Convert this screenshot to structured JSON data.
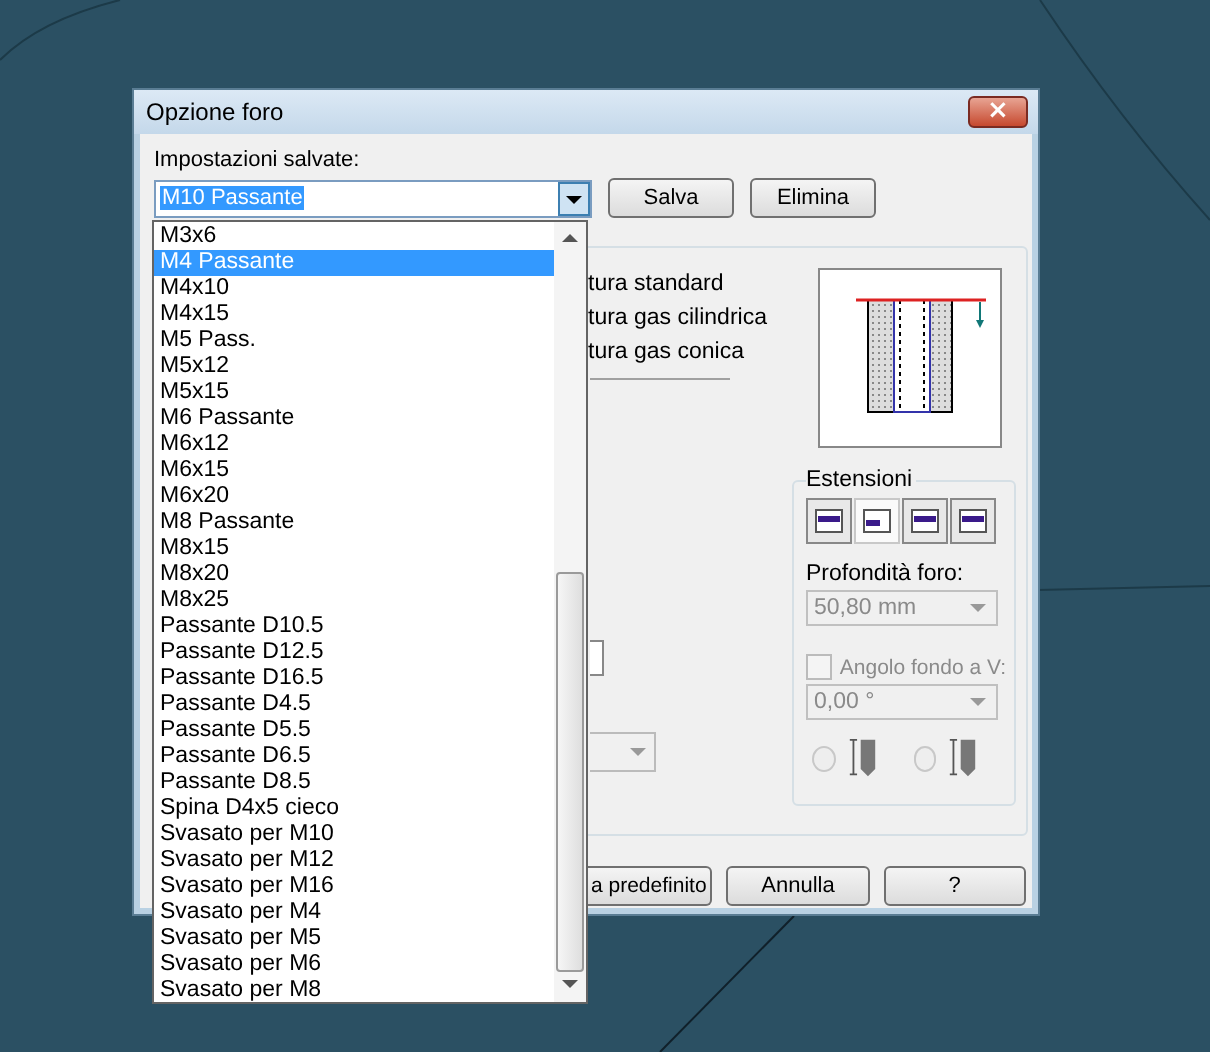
{
  "window": {
    "title": "Opzione foro",
    "close": "×"
  },
  "saved_settings": {
    "label": "Impostazioni salvate:",
    "value": "M10 Passante",
    "buttons": [
      "Salva",
      "Elimina"
    ]
  },
  "dropdown_list": {
    "items": [
      {
        "label": "M3x6",
        "selected": false
      },
      {
        "label": "M4 Passante",
        "selected": true
      },
      {
        "label": "M4x10",
        "selected": false
      },
      {
        "label": "M4x15",
        "selected": false
      },
      {
        "label": "M5 Pass.",
        "selected": false
      },
      {
        "label": "M5x12",
        "selected": false
      },
      {
        "label": "M5x15",
        "selected": false
      },
      {
        "label": "M6 Passante",
        "selected": false
      },
      {
        "label": "M6x12",
        "selected": false
      },
      {
        "label": "M6x15",
        "selected": false
      },
      {
        "label": "M6x20",
        "selected": false
      },
      {
        "label": "M8 Passante",
        "selected": false
      },
      {
        "label": "M8x15",
        "selected": false
      },
      {
        "label": "M8x20",
        "selected": false
      },
      {
        "label": "M8x25",
        "selected": false
      },
      {
        "label": "Passante D10.5",
        "selected": false
      },
      {
        "label": "Passante D12.5",
        "selected": false
      },
      {
        "label": "Passante D16.5",
        "selected": false
      },
      {
        "label": "Passante D4.5",
        "selected": false
      },
      {
        "label": "Passante D5.5",
        "selected": false
      },
      {
        "label": "Passante D6.5",
        "selected": false
      },
      {
        "label": "Passante D8.5",
        "selected": false
      },
      {
        "label": "Spina D4x5 cieco",
        "selected": false
      },
      {
        "label": "Svasato per M10",
        "selected": false
      },
      {
        "label": "Svasato per M12",
        "selected": false
      },
      {
        "label": "Svasato per M16",
        "selected": false
      },
      {
        "label": "Svasato per M4",
        "selected": false
      },
      {
        "label": "Svasato per M5",
        "selected": false
      },
      {
        "label": "Svasato per M6",
        "selected": false
      },
      {
        "label": "Svasato per M8",
        "selected": false
      }
    ]
  },
  "thread_options": [
    "tura standard",
    "tura gas cilindrica",
    "tura gas conica"
  ],
  "extensions": {
    "label": "Estensioni",
    "buttons": [
      {
        "selected": false
      },
      {
        "selected": true
      },
      {
        "selected": false
      },
      {
        "selected": false
      }
    ]
  },
  "depth": {
    "label": "Profondità foro:",
    "value": "50,80 mm",
    "disabled": true
  },
  "v_angle": {
    "label": "Angolo fondo a V:",
    "checked": false,
    "value": "0,00 °",
    "disabled": true,
    "radios": [
      {
        "selected": false
      },
      {
        "selected": false
      }
    ]
  },
  "footer_buttons": [
    "a predefinito",
    "Annulla",
    "?"
  ]
}
